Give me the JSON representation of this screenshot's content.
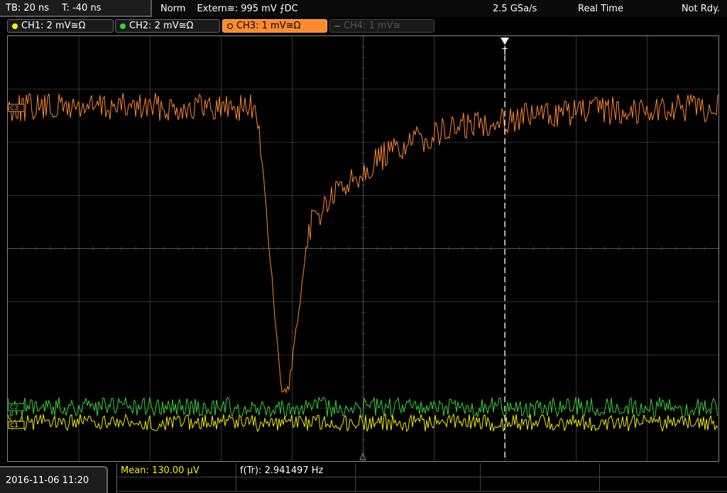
{
  "topbar": {
    "timebase": "TB: 20 ns",
    "trigger_offset": "T: -40 ns",
    "trigger_mode": "Norm",
    "trigger_source": "Extern≅: 995 mV ⨍DC",
    "sample_rate": "2.5 GSa/s",
    "acq_mode": "Real Time",
    "status": "Not Rdy."
  },
  "channels": [
    {
      "label": "CH1: 2 mV≅Ω",
      "color": "#f5f000",
      "state": "on"
    },
    {
      "label": "CH2: 2 mV≅Ω",
      "color": "#34d43a",
      "state": "on"
    },
    {
      "label": "CH3: 1 mV≅Ω",
      "color": "#ff8a2e",
      "state": "active"
    },
    {
      "label": "CH4: 1 mV≅",
      "color": "#555555",
      "state": "off"
    }
  ],
  "markers": {
    "trigger": "T",
    "ch3_ref": "C3",
    "ch2_ref": "C2",
    "ch1_ref": "C1"
  },
  "bottom": {
    "datetime": "2016-11-06 11:20",
    "mean_label": "Mean: 130.00 μV",
    "freq_label": "f(Tr): 2.941497 Hz"
  },
  "colors": {
    "ch1": "#f5f000",
    "ch2": "#34d43a",
    "ch3": "#ff8a2e",
    "grid": "#5a5a5a"
  }
}
